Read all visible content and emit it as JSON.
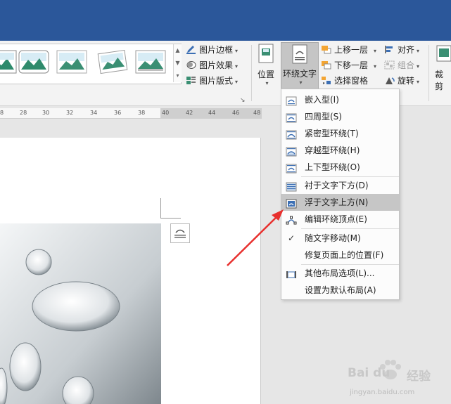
{
  "ribbon": {
    "picture_border": "图片边框",
    "picture_effects": "图片效果",
    "picture_layout": "图片版式",
    "position": "位置",
    "wrap_text": "环绕文字",
    "bring_forward": "上移一层",
    "send_backward": "下移一层",
    "selection_pane": "选择窗格",
    "align": "对齐",
    "group": "组合",
    "rotate": "旋转",
    "crop_partial": "裁剪",
    "launcher": "↘"
  },
  "ruler": {
    "ticks": [
      "8",
      "28",
      "30",
      "32",
      "34",
      "36",
      "38",
      "40",
      "42",
      "44",
      "46",
      "48"
    ]
  },
  "wrap_menu": {
    "items": [
      "嵌入型(I)",
      "四周型(S)",
      "紧密型环绕(T)",
      "穿越型环绕(H)",
      "上下型环绕(O)",
      "衬于文字下方(D)",
      "浮于文字上方(N)",
      "编辑环绕顶点(E)",
      "随文字移动(M)",
      "修复页面上的位置(F)",
      "其他布局选项(L)...",
      "设置为默认布局(A)"
    ],
    "check_mark": "✓"
  },
  "watermark": {
    "brand": "Bai du",
    "product": "经验",
    "url": "jingyan.baidu.com"
  },
  "colors": {
    "titlebar": "#2b579a",
    "selected_item": "#c6c6c6",
    "arrow": "#e8302e"
  }
}
